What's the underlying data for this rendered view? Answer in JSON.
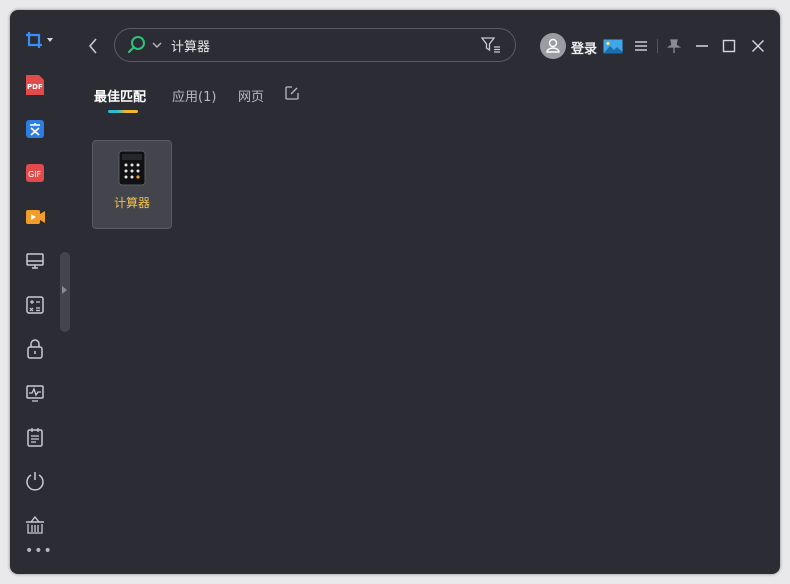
{
  "header": {
    "search": {
      "value": "计算器",
      "placeholder": ""
    },
    "login_label": "登录"
  },
  "tabs": [
    {
      "label": "最佳匹配",
      "active": true
    },
    {
      "label": "应用(1)",
      "active": false
    },
    {
      "label": "网页",
      "active": false
    }
  ],
  "results": [
    {
      "name": "计算器",
      "icon": "calculator-icon"
    }
  ],
  "sidebar": {
    "items": [
      {
        "icon": "screenshot-icon"
      },
      {
        "icon": "pdf-icon",
        "label": "PDF"
      },
      {
        "icon": "translate-icon"
      },
      {
        "icon": "gif-icon",
        "label": "GIF"
      },
      {
        "icon": "video-icon"
      },
      {
        "icon": "monitor-icon"
      },
      {
        "icon": "calculator-tool-icon"
      },
      {
        "icon": "lock-icon"
      },
      {
        "icon": "system-monitor-icon"
      },
      {
        "icon": "notepad-icon"
      },
      {
        "icon": "power-icon"
      },
      {
        "icon": "cleanup-basket-icon"
      },
      {
        "icon": "more-icon"
      }
    ]
  },
  "colors": {
    "background": "#2c2d34",
    "accent_highlight": "#f3c24a",
    "search_icon": "#2fc27a",
    "pdf_red": "#e24b4b",
    "translate_blue": "#2d7ee0",
    "video_orange": "#f39c29"
  }
}
